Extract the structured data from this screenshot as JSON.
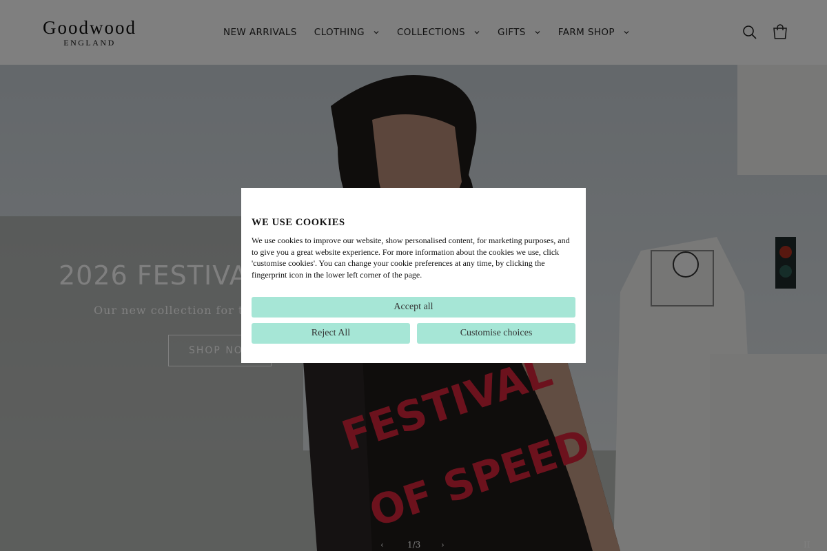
{
  "brand": {
    "name": "Goodwood",
    "sub": "ENGLAND"
  },
  "nav": [
    {
      "label": "NEW ARRIVALS",
      "dropdown": false
    },
    {
      "label": "CLOTHING",
      "dropdown": true
    },
    {
      "label": "COLLECTIONS",
      "dropdown": true
    },
    {
      "label": "GIFTS",
      "dropdown": true
    },
    {
      "label": "FARM SHOP",
      "dropdown": true
    }
  ],
  "header_icons": [
    "search-icon",
    "cart-icon"
  ],
  "hero": {
    "title": "2026 FESTIVAL",
    "subtitle": "Our new collection for the Fes",
    "button": "SHOP NOW",
    "counter": "1/3",
    "prev": "‹",
    "next": "›",
    "pause": "II"
  },
  "cookie": {
    "title": "WE USE COOKIES",
    "text": "We use cookies to improve our website, show personalised content, for marketing purposes, and to give you a great website experience. For more information about the cookies we use, click 'customise cookies'. You can change your cookie preferences at any time, by clicking the fingerprint icon in the lower left corner of the page.",
    "accept": "Accept all",
    "reject": "Reject All",
    "customise": "Customise choices"
  },
  "colors": {
    "cookie_button": "#a6e6d6",
    "overlay": "rgba(0,0,0,0.5)",
    "shirt_print": "#d8253b"
  }
}
